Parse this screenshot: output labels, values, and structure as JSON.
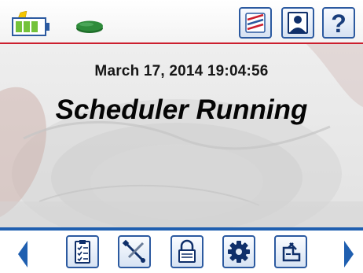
{
  "status": {
    "battery_icon": "battery-charging-icon",
    "indicator_icon": "status-led-icon",
    "indicator_color": "#2e8b3a"
  },
  "toolbar": {
    "buttons": [
      {
        "name": "chart-button",
        "icon": "chart-lines-icon"
      },
      {
        "name": "user-button",
        "icon": "user-icon"
      },
      {
        "name": "help-button",
        "icon": "help-icon",
        "glyph": "?"
      }
    ]
  },
  "main": {
    "datetime": "March 17, 2014 19:04:56",
    "status_text": "Scheduler Running"
  },
  "nav": {
    "buttons": [
      {
        "name": "checklist-button",
        "icon": "checklist-icon"
      },
      {
        "name": "tools-button",
        "icon": "wrench-screwdriver-icon"
      },
      {
        "name": "lock-button",
        "icon": "lock-icon"
      },
      {
        "name": "settings-button",
        "icon": "gear-icon"
      },
      {
        "name": "valve-button",
        "icon": "valve-icon"
      }
    ]
  },
  "colors": {
    "accent_blue": "#2c5aa0",
    "divider_red": "#cc1f2e",
    "divider_blue": "#1f5fb0"
  }
}
